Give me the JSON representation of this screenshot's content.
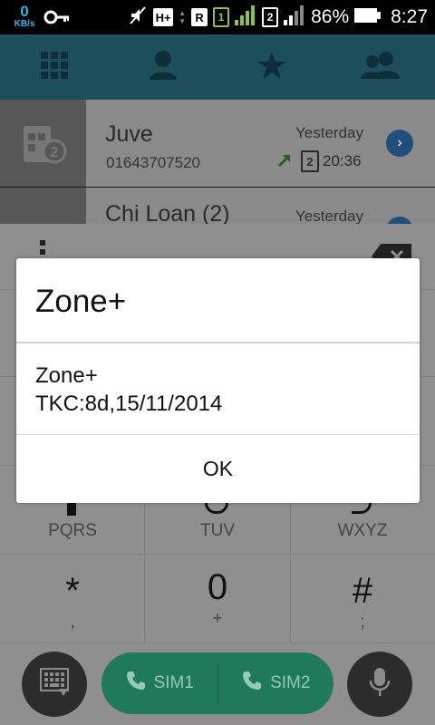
{
  "status_bar": {
    "net_speed_value": "0",
    "net_speed_unit": "KB/s",
    "network_type": "H+",
    "roaming": "R",
    "sim1_label": "1",
    "sim2_label": "2",
    "battery_percent": "86%",
    "time": "8:27",
    "icons": [
      "key-icon",
      "mute-icon",
      "signal-icon",
      "battery-icon"
    ]
  },
  "tabs": [
    {
      "icon": "dialpad-icon"
    },
    {
      "icon": "contact-icon"
    },
    {
      "icon": "star-icon"
    },
    {
      "icon": "group-icon"
    }
  ],
  "call_log": [
    {
      "name": "Juve",
      "number": "01643707520",
      "when": "Yesterday",
      "sim": "2",
      "time": "20:36",
      "direction": "outgoing"
    },
    {
      "name": "Chi Loan (2)",
      "when": "Yesterday"
    }
  ],
  "dialpad": {
    "keys": [
      {
        "letters": "PQRS"
      },
      {
        "letters": "TUV"
      },
      {
        "letters": "WXYZ"
      },
      {
        "digit": "*",
        "letters": ","
      },
      {
        "digit": "0",
        "letters": "+"
      },
      {
        "digit": "#",
        "letters": ";"
      }
    ]
  },
  "call_buttons": {
    "sim1_label": "SIM1",
    "sim2_label": "SIM2"
  },
  "dialog": {
    "title": "Zone+",
    "message_line1": "Zone+",
    "message_line2": "TKC:8d,15/11/2014",
    "ok_label": "OK"
  },
  "colors": {
    "tab_bar": "#1d4e5c",
    "call_button": "#1e7a5a",
    "accent_blue": "#33b5e5"
  }
}
